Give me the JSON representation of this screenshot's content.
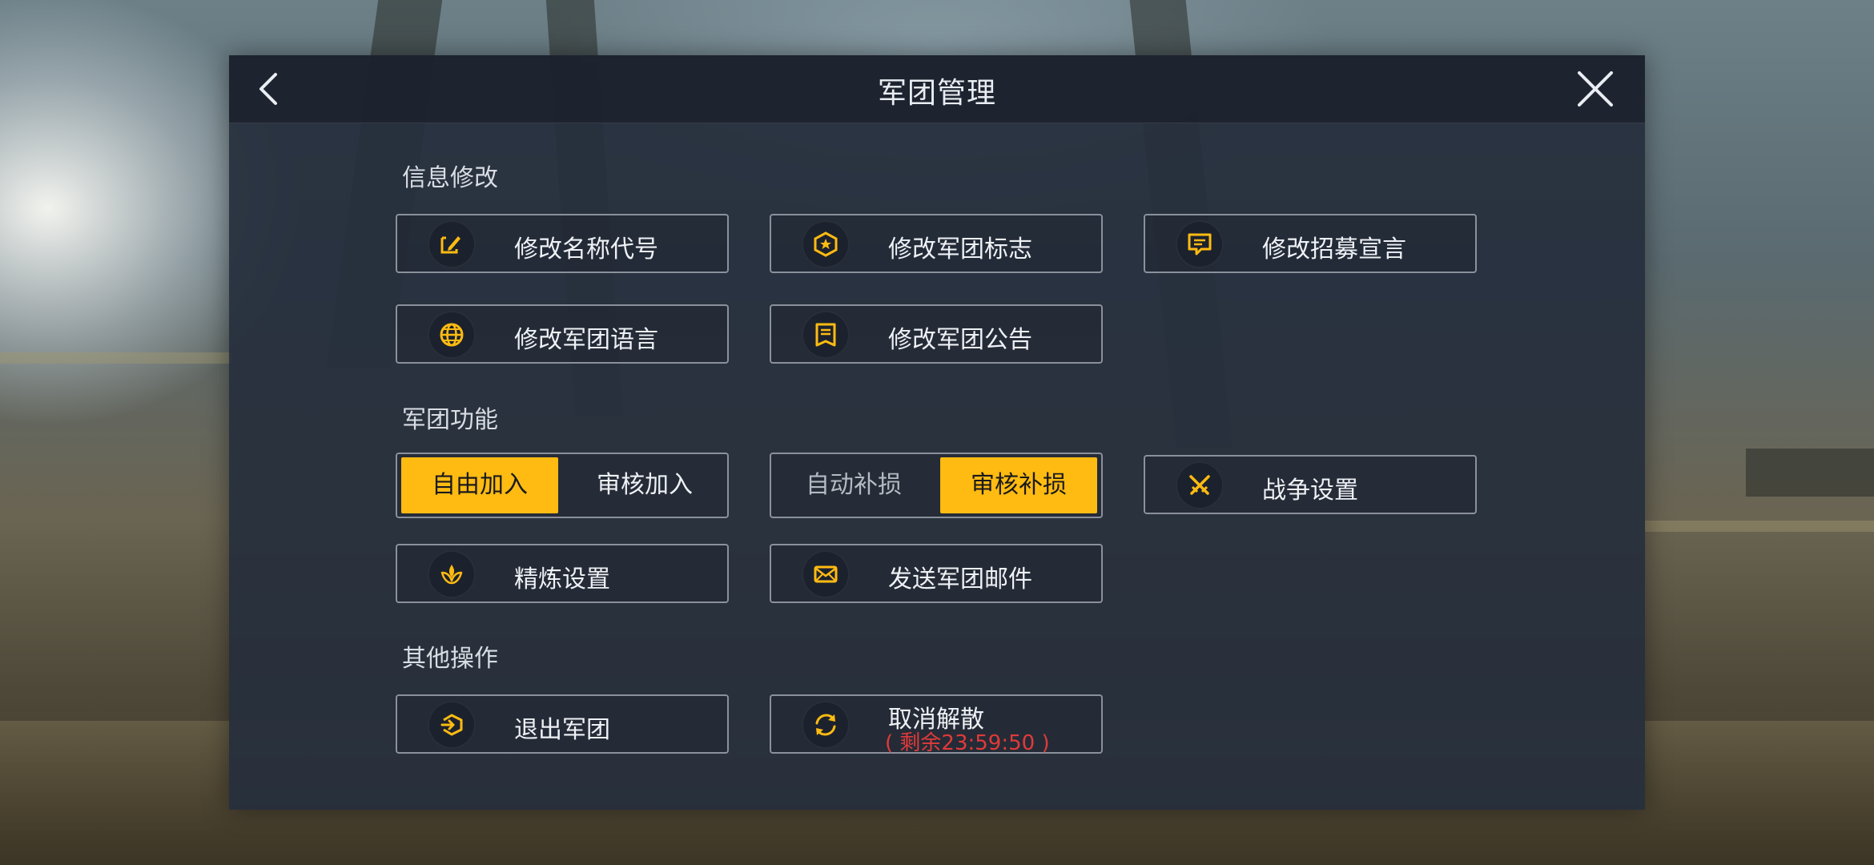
{
  "header": {
    "title": "军团管理"
  },
  "sections": {
    "info": "信息修改",
    "function": "军团功能",
    "other": "其他操作"
  },
  "buttons": {
    "edit_name": "修改名称代号",
    "edit_emblem": "修改军团标志",
    "edit_recruit": "修改招募宣言",
    "edit_language": "修改军团语言",
    "edit_notice": "修改军团公告",
    "war_settings": "战争设置",
    "refine_settings": "精炼设置",
    "send_mail": "发送军团邮件",
    "leave": "退出军团",
    "cancel_disband": "取消解散",
    "cancel_disband_remaining": "( 剩余23:59:50 )"
  },
  "toggles": {
    "join": {
      "left": "自由加入",
      "right": "审核加入",
      "selected": "left"
    },
    "repair": {
      "left": "自动补损",
      "right": "审核补损",
      "selected": "right"
    }
  },
  "colors": {
    "accent": "#ffbb12",
    "panel": "#262e3c",
    "countdown": "#e03a3a"
  }
}
